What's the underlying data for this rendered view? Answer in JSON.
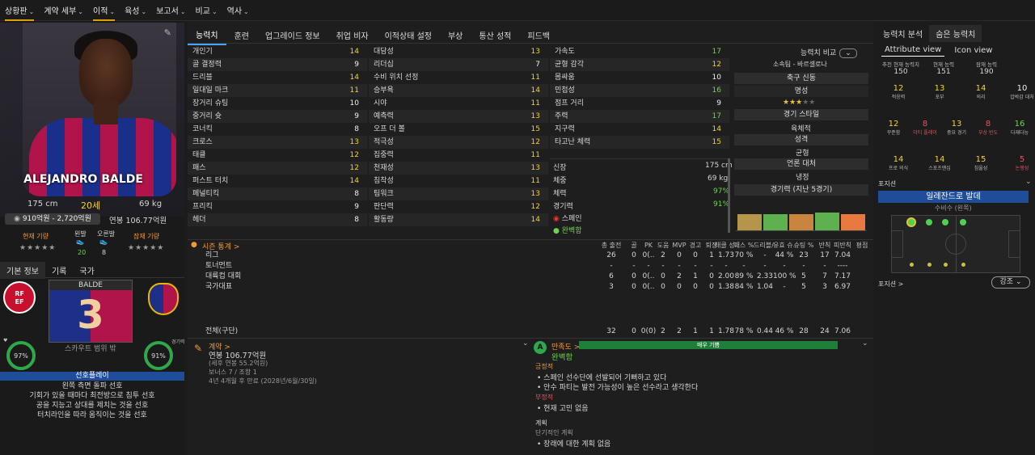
{
  "nav": [
    {
      "label": "상황판",
      "active": true
    },
    {
      "label": "계약 세부",
      "active": false
    },
    {
      "label": "이적",
      "active": true
    },
    {
      "label": "육성",
      "active": false
    },
    {
      "label": "보고서",
      "active": false
    },
    {
      "label": "비교",
      "active": false
    },
    {
      "label": "역사",
      "active": false
    }
  ],
  "player": {
    "name_on_shirt": "ALEJANDRO BALDE",
    "height": "175 cm",
    "age": "20세",
    "weight": "69 kg",
    "value": "910억원 - 2,720억원",
    "wage": "연봉 106.77억원",
    "current_label": "현재 기량",
    "potential_label": "잠재 기량",
    "foot_left_label": "왼발",
    "foot_right_label": "오른발",
    "foot_left": "20",
    "foot_right": "8",
    "shirt_name": "BALDE",
    "shirt_number": "3",
    "scout_text": "스카우트 범위 밖",
    "ring_left": "97%",
    "ring_right": "91%",
    "ring_right_label": "경기력"
  },
  "left_tabs": [
    "기본 정보",
    "기록",
    "국가"
  ],
  "pref": {
    "title": "선호플레이",
    "items": [
      "왼쪽 측면 돌파 선호",
      "기회가 있을 때마다 최전방으로 침투 선호",
      "공을 지능고 상대를 제치는 것을 선호",
      "터치라인을 따라 움직이는 것을 선호"
    ]
  },
  "center_tabs": [
    "능력치",
    "훈련",
    "업그레이드 정보",
    "취업 비자",
    "이적상태 설정",
    "부상",
    "통산 성적",
    "피드백"
  ],
  "attr_col1": [
    [
      "개인기",
      "14",
      "yellow"
    ],
    [
      "골 결정력",
      "9",
      "white"
    ],
    [
      "드리블",
      "14",
      "yellow"
    ],
    [
      "일대일 마크",
      "11",
      "yellow"
    ],
    [
      "장거리 슈팅",
      "10",
      "white"
    ],
    [
      "중거리 슛",
      "9",
      "white"
    ],
    [
      "코너킥",
      "8",
      "white"
    ],
    [
      "크로스",
      "13",
      "yellow"
    ],
    [
      "태클",
      "12",
      "yellow"
    ],
    [
      "패스",
      "12",
      "yellow"
    ],
    [
      "퍼스트 터치",
      "14",
      "yellow"
    ],
    [
      "페널티킥",
      "8",
      "white"
    ],
    [
      "프리킥",
      "9",
      "white"
    ],
    [
      "헤더",
      "8",
      "white"
    ]
  ],
  "attr_col2": [
    [
      "대담성",
      "13",
      "yellow"
    ],
    [
      "리더십",
      "7",
      "white"
    ],
    [
      "수비 위치 선정",
      "11",
      "yellow"
    ],
    [
      "승부욕",
      "14",
      "yellow"
    ],
    [
      "시야",
      "11",
      "yellow"
    ],
    [
      "예측력",
      "13",
      "yellow"
    ],
    [
      "오프 더 볼",
      "15",
      "yellow"
    ],
    [
      "적극성",
      "12",
      "yellow"
    ],
    [
      "집중력",
      "11",
      "yellow"
    ],
    [
      "천재성",
      "13",
      "yellow"
    ],
    [
      "침착성",
      "11",
      "yellow"
    ],
    [
      "팀워크",
      "13",
      "yellow"
    ],
    [
      "판단력",
      "12",
      "yellow"
    ],
    [
      "활동량",
      "14",
      "yellow"
    ]
  ],
  "attr_col3": [
    [
      "가속도",
      "17",
      "green"
    ],
    [
      "균형 감각",
      "12",
      "yellow"
    ],
    [
      "몸싸움",
      "10",
      "white"
    ],
    [
      "민첩성",
      "16",
      "green"
    ],
    [
      "점프 거리",
      "9",
      "white"
    ],
    [
      "주력",
      "17",
      "green"
    ],
    [
      "지구력",
      "14",
      "yellow"
    ],
    [
      "타고난 체력",
      "15",
      "yellow"
    ]
  ],
  "physical": {
    "height_label": "신장",
    "height": "175 cm",
    "weight_label": "체중",
    "weight": "69 kg",
    "fitness_label": "체력",
    "fitness": "97%",
    "match_label": "경기력",
    "match": "91%",
    "nation": "스페인",
    "status": "완벽함"
  },
  "compare": {
    "button": "능력치 비교",
    "club": "소속팀 - 바르셀로나",
    "recruit": "축구 신동",
    "fame_label": "명성",
    "style_label": "경기 스타일",
    "style": "육체적",
    "pers_label": "성격",
    "pers": "균형",
    "media_label": "언론 대처",
    "media": "냉정",
    "form_label": "경기력 (지난 5경기)",
    "stars": 3
  },
  "form_bars": [
    [
      "#b5954a",
      0.55
    ],
    [
      "#5fb04f",
      0.55
    ],
    [
      "#c9843f",
      0.55
    ],
    [
      "#5fb04f",
      0.6
    ],
    [
      "#e8793f",
      0.55
    ]
  ],
  "season": {
    "title": "시즌 통계 >",
    "headers": [
      "총 출전",
      "골",
      "PK",
      "도움",
      "MVP",
      "경고",
      "퇴장",
      "태클 성..",
      "패스 %",
      "드리블/..",
      "유효 슈..",
      "슈팅 %",
      "반칙",
      "피반칙",
      "평점"
    ],
    "rows": [
      [
        "리그",
        "26",
        "0",
        "0(..",
        "2",
        "0",
        "0",
        "1",
        "1.73",
        "70 %",
        "-",
        "44 %",
        "23",
        "17",
        "7.04"
      ],
      [
        "토너먼트",
        "-",
        "-",
        "-",
        "-",
        "-",
        "-",
        "-",
        "-",
        "-",
        "-",
        "-",
        "-",
        "-",
        "----"
      ],
      [
        "대륙컵 대회",
        "6",
        "0",
        "0(..",
        "0",
        "2",
        "1",
        "0",
        "2.00",
        "89 %",
        "2.33",
        "100 %",
        "5",
        "7",
        "7.17"
      ],
      [
        "국가대표",
        "3",
        "0",
        "0(..",
        "0",
        "0",
        "0",
        "0",
        "1.38",
        "84 %",
        "1.04",
        "-",
        "5",
        "3",
        "6.97"
      ]
    ],
    "total": [
      "전체(구단)",
      "32",
      "0",
      "0(0)",
      "2",
      "2",
      "1",
      "1",
      "1.78",
      "78 %",
      "0.44",
      "46 %",
      "28",
      "24",
      "7.06"
    ]
  },
  "contract": {
    "title": "계약 >",
    "wage": "연봉 106.77억원",
    "line2": "(세후 연봉 55.2억원)",
    "line3": "보너스 7 / 조항 1",
    "line4": "4년 4개월 후 만료 (2028년/6월/30일)"
  },
  "happy": {
    "title": "만족도 >",
    "bar": "매우 기쁨",
    "status": "완벽함",
    "pos_title": "긍정적",
    "pos": [
      "스페인 선수단에 선발되어 기뻐하고 있다",
      "안수 파티는 발전 가능성이 높은 선수라고 생각한다"
    ],
    "neg_title": "부정적",
    "neg": [
      "현재 고민 없음"
    ],
    "plan_title": "계획",
    "plan_sub": "단기적인 계획",
    "plan": [
      "장래에 대한 계획 없음"
    ]
  },
  "right": {
    "tabs": [
      "능력치 분석",
      "숨은 능력치"
    ],
    "views": [
      "Attribute view",
      "Icon view"
    ],
    "top": [
      [
        "추천 현재 능력치",
        "150"
      ],
      [
        "현재 능력",
        "151"
      ],
      [
        "잠재 능력",
        "190"
      ]
    ],
    "grid": [
      [
        "12",
        "적응력",
        "yellow"
      ],
      [
        "13",
        "포부",
        "yellow"
      ],
      [
        "14",
        "의리",
        "yellow"
      ],
      [
        "10",
        "압박감 대처",
        "white"
      ],
      [
        "12",
        "꾸준함",
        "yellow"
      ],
      [
        "8",
        "더티 플레이",
        "red"
      ],
      [
        "13",
        "중요 경기",
        "yellow"
      ],
      [
        "8",
        "부상 빈도",
        "red"
      ],
      [
        "16",
        "다재다능",
        "green"
      ],
      [
        "14",
        "프로 의식",
        "yellow"
      ],
      [
        "14",
        "스포츠맨십",
        "yellow"
      ],
      [
        "15",
        "침울성",
        "yellow"
      ],
      [
        "5",
        "논쟁성",
        "red"
      ]
    ],
    "pos_title": "포지션",
    "pos_name": "일레잔드로 발데",
    "pos_role": "수비수 (왼쪽)",
    "pos2": "포지션 >",
    "strength": "강조"
  }
}
